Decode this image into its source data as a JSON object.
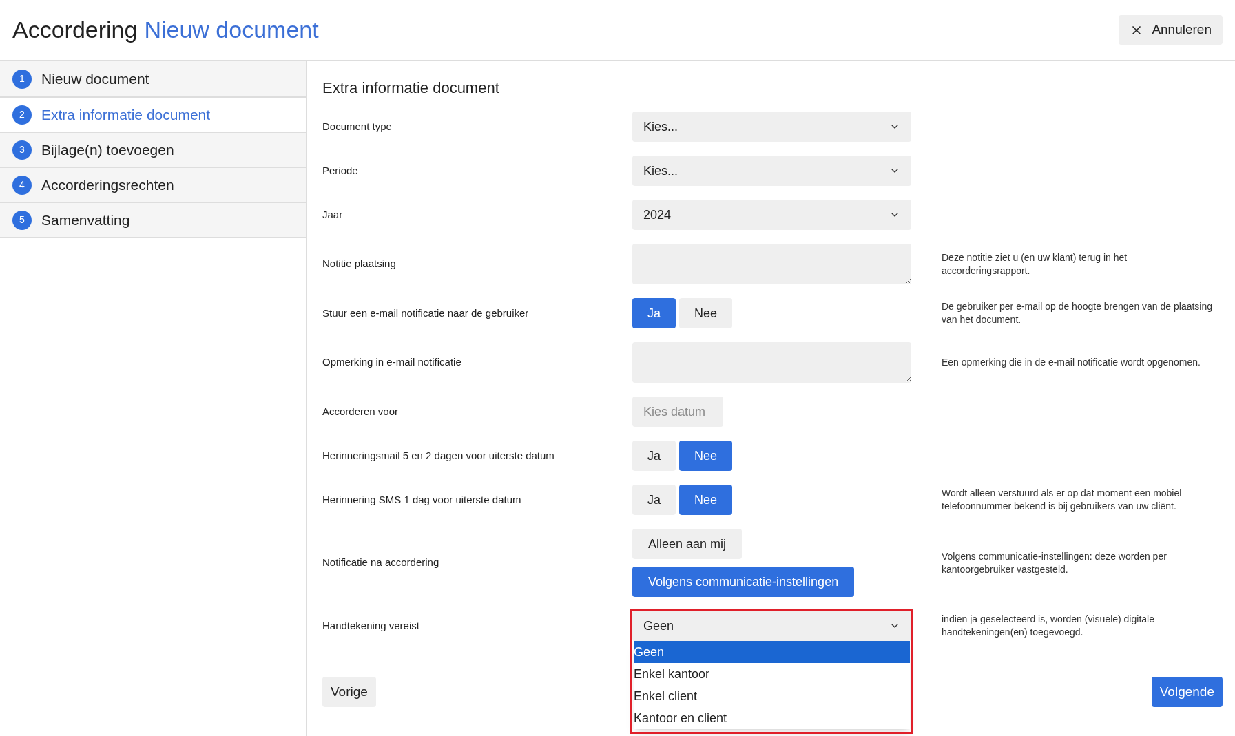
{
  "header": {
    "title": "Accordering",
    "subtitle": "Nieuw document",
    "cancel": "Annuleren"
  },
  "steps": [
    {
      "number": "1",
      "label": "Nieuw document",
      "selected": false
    },
    {
      "number": "2",
      "label": "Extra informatie document",
      "selected": true
    },
    {
      "number": "3",
      "label": "Bijlage(n) toevoegen",
      "selected": false
    },
    {
      "number": "4",
      "label": "Accorderingsrechten",
      "selected": false
    },
    {
      "number": "5",
      "label": "Samenvatting",
      "selected": false
    }
  ],
  "form": {
    "heading": "Extra informatie document",
    "fields": [
      {
        "kind": "select",
        "label": "Document type",
        "value": "Kies..."
      },
      {
        "kind": "select",
        "label": "Periode",
        "value": "Kies..."
      },
      {
        "kind": "select",
        "label": "Jaar",
        "value": "2024"
      },
      {
        "kind": "textarea",
        "label": "Notitie plaatsing",
        "help": "Deze notitie ziet u (en uw klant) terug in het accorderingsrapport."
      },
      {
        "kind": "toggle",
        "label": "Stuur een e-mail notificatie naar de gebruiker",
        "options": [
          {
            "label": "Ja",
            "selected": true
          },
          {
            "label": "Nee",
            "selected": false
          }
        ],
        "help": "De gebruiker per e-mail op de hoogte brengen van de plaatsing van het document."
      },
      {
        "kind": "textarea",
        "label": "Opmerking in e-mail notificatie",
        "help": "Een opmerking die in de e-mail notificatie wordt opgenomen."
      },
      {
        "kind": "date",
        "label": "Accorderen voor",
        "placeholder": "Kies datum"
      },
      {
        "kind": "toggle",
        "label": "Herinneringsmail 5 en 2 dagen voor uiterste datum",
        "options": [
          {
            "label": "Ja",
            "selected": false
          },
          {
            "label": "Nee",
            "selected": true
          }
        ]
      },
      {
        "kind": "toggle",
        "label": "Herinnering SMS 1 dag voor uiterste datum",
        "options": [
          {
            "label": "Ja",
            "selected": false
          },
          {
            "label": "Nee",
            "selected": true
          }
        ],
        "help": "Wordt alleen verstuurd als er op dat moment een mobiel telefoonnummer bekend is bij gebruikers van uw cliënt."
      },
      {
        "kind": "stack",
        "label": "Notificatie na accordering",
        "options": [
          {
            "label": "Alleen aan mij",
            "selected": false
          },
          {
            "label": "Volgens communicatie-instellingen",
            "selected": true
          }
        ],
        "help": "Volgens communicatie-instellingen: deze worden per kantoorgebruiker vastgesteld."
      },
      {
        "kind": "select",
        "label": "Handtekening vereist",
        "value": "Geen",
        "open": true,
        "highlighted": true,
        "options": [
          {
            "label": "Geen",
            "selected": true
          },
          {
            "label": "Enkel kantoor",
            "selected": false
          },
          {
            "label": "Enkel client",
            "selected": false
          },
          {
            "label": "Kantoor en client",
            "selected": false
          }
        ],
        "help": "indien ja geselecteerd is, worden (visuele) digitale handtekeningen(en) toegevoegd."
      }
    ]
  },
  "footer": {
    "previous": "Vorige",
    "next": "Volgende"
  }
}
